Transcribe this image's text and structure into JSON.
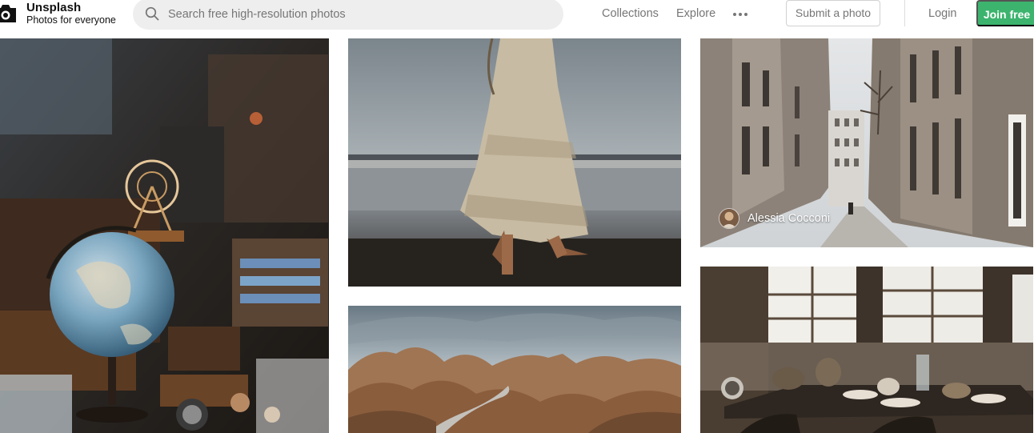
{
  "brand": {
    "name": "Unsplash",
    "tagline": "Photos for everyone"
  },
  "search": {
    "placeholder": "Search free high-resolution photos",
    "value": ""
  },
  "nav": {
    "collections": "Collections",
    "explore": "Explore",
    "more_icon": "more-horizontal-icon",
    "submit": "Submit a photo",
    "login": "Login",
    "join": "Join free"
  },
  "colors": {
    "join_button": "#3cb46e",
    "search_bg": "#eeeeee",
    "nav_text": "#767676"
  },
  "photos": [
    {
      "subject": "vintage globe and ferris wheel in shop window"
    },
    {
      "subject": "woman in white dress walking on beach"
    },
    {
      "subject": "eroded brown hills under cloudy sky"
    },
    {
      "subject": "narrow Paris street",
      "credit": "Alessia Cocconi"
    },
    {
      "subject": "table with teapots near windows"
    }
  ]
}
